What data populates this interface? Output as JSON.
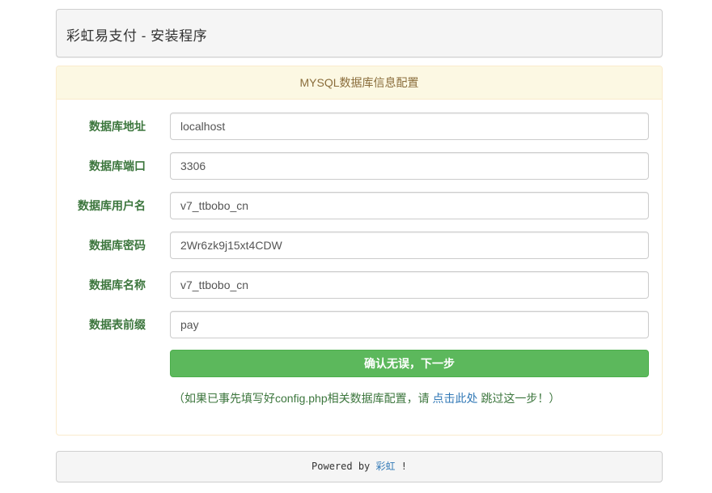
{
  "header": {
    "title": "彩虹易支付 - 安装程序"
  },
  "panel": {
    "heading": "MYSQL数据库信息配置",
    "fields": [
      {
        "label": "数据库地址",
        "value": "localhost"
      },
      {
        "label": "数据库端口",
        "value": "3306"
      },
      {
        "label": "数据库用户名",
        "value": "v7_ttbobo_cn"
      },
      {
        "label": "数据库密码",
        "value": "2Wr6zk9j15xt4CDW"
      },
      {
        "label": "数据库名称",
        "value": "v7_ttbobo_cn"
      },
      {
        "label": "数据表前缀",
        "value": "pay"
      }
    ],
    "submit_label": "确认无误，下一步",
    "hint": {
      "before": "（如果已事先填写好config.php相关数据库配置，请 ",
      "link": "点击此处",
      "after": " 跳过这一步！）"
    }
  },
  "footer": {
    "before": "Powered by ",
    "link": "彩虹",
    "after": " !"
  },
  "colors": {
    "success_green": "#5cb85c",
    "label_green": "#3c763d",
    "warning_bg": "#fcf8e3",
    "link_blue": "#337ab7"
  }
}
